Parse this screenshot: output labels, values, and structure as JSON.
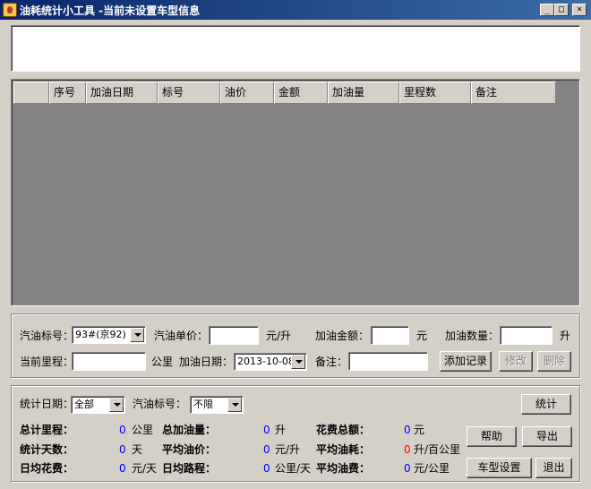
{
  "window": {
    "title": "油耗统计小工具 -当前未设置车型信息",
    "minimize": "_",
    "maximize": "□",
    "close": "×"
  },
  "grid": {
    "columns": [
      "",
      "序号",
      "加油日期",
      "标号",
      "油价",
      "金额",
      "加油量",
      "里程数",
      "备注"
    ]
  },
  "entry": {
    "fuel_grade_label": "汽油标号：",
    "fuel_grade_value": "93#(京92)",
    "unit_price_label": "汽油单价：",
    "unit_price_unit": "元/升",
    "amount_label": "加油金额：",
    "amount_unit": "元",
    "quantity_label": "加油数量：",
    "quantity_unit": "升",
    "mileage_label": "当前里程：",
    "mileage_unit": "公里",
    "date_label": "加油日期：",
    "date_value": "2013-10-08",
    "note_label": "备注：",
    "add_button": "添加记录",
    "edit_button": "修改",
    "delete_button": "删除"
  },
  "stats": {
    "date_label": "统计日期：",
    "date_value": "全部",
    "grade_label": "汽油标号：",
    "grade_value": "不限",
    "stats_button": "统计",
    "total_mileage_label": "总计里程：",
    "total_mileage_value": "0",
    "total_mileage_unit": "公里",
    "total_fuel_label": "总加油量：",
    "total_fuel_value": "0",
    "total_fuel_unit": "升",
    "total_cost_label": "花费总额：",
    "total_cost_value": "0",
    "total_cost_unit": "元",
    "days_label": "统计天数：",
    "days_value": "0",
    "days_unit": "天",
    "avg_price_label": "平均油价：",
    "avg_price_value": "0",
    "avg_price_unit": "元/升",
    "avg_consumption_label": "平均油耗：",
    "avg_consumption_value": "0",
    "avg_consumption_unit": "升/百公里",
    "daily_cost_label": "日均花费：",
    "daily_cost_value": "0",
    "daily_cost_unit": "元/天",
    "daily_distance_label": "日均路程：",
    "daily_distance_value": "0",
    "daily_distance_unit": "公里/天",
    "avg_fuel_cost_label": "平均油费：",
    "avg_fuel_cost_value": "0",
    "avg_fuel_cost_unit": "元/公里",
    "help_button": "帮助",
    "export_button": "导出",
    "car_settings_button": "车型设置",
    "exit_button": "退出"
  },
  "colors": {
    "value_blue": "#0000ff",
    "value_red": "#ff0000",
    "grid_bg": "#858386",
    "title_bar": "#0a246a"
  }
}
